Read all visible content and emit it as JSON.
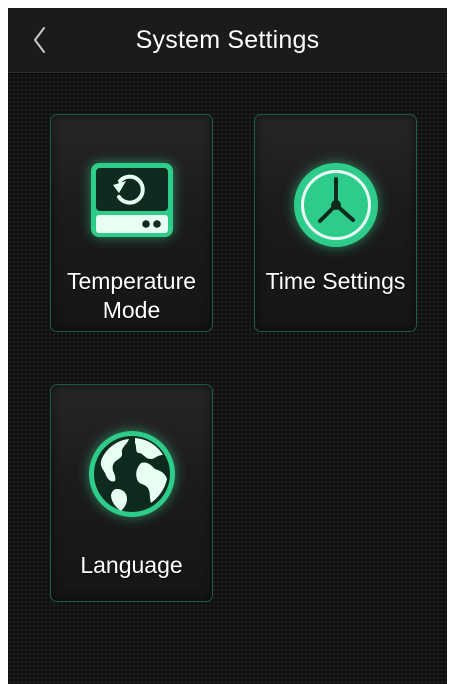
{
  "header": {
    "title": "System Settings",
    "back_icon": "chevron-left-icon"
  },
  "tiles": [
    {
      "label_line1": "Temperature",
      "label_line2": "Mode",
      "icon": "temperature-mode-icon"
    },
    {
      "label": "Time Settings",
      "icon": "clock-icon"
    },
    {
      "label": "Language",
      "icon": "globe-icon"
    }
  ],
  "colors": {
    "background": "#141414",
    "tile_border": "#1d5a40",
    "icon_green": "#2ecc8a",
    "icon_light": "#d8fff0",
    "text": "#ffffff"
  }
}
